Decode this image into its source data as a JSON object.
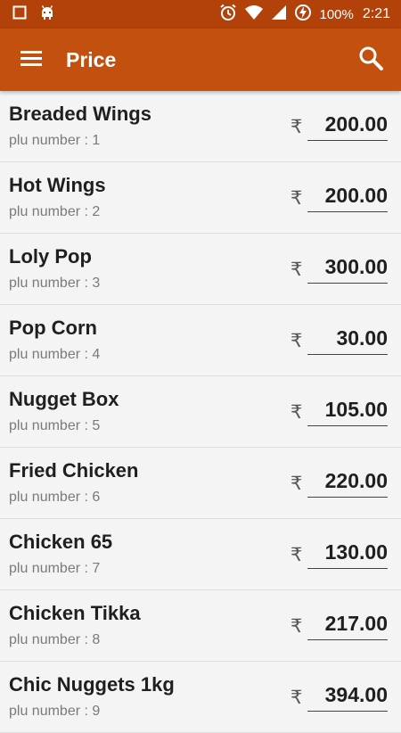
{
  "status_bar": {
    "battery": "100%",
    "time": "2:21",
    "icons": [
      "square-icon",
      "android-icon",
      "alarm-icon",
      "wifi-icon",
      "signal-icon",
      "battery-charging-icon"
    ]
  },
  "app_bar": {
    "title": "Price",
    "menu_icon": "menu-icon",
    "search_icon": "search-icon"
  },
  "currency_symbol": "₹",
  "plu_label": "plu number : ",
  "items": [
    {
      "name": "Breaded Wings",
      "plu": "1",
      "price": "200.00"
    },
    {
      "name": "Hot Wings",
      "plu": "2",
      "price": "200.00"
    },
    {
      "name": "Loly Pop",
      "plu": "3",
      "price": "300.00"
    },
    {
      "name": "Pop Corn",
      "plu": "4",
      "price": "30.00"
    },
    {
      "name": "Nugget Box",
      "plu": "5",
      "price": "105.00"
    },
    {
      "name": "Fried Chicken",
      "plu": "6",
      "price": "220.00"
    },
    {
      "name": "Chicken 65",
      "plu": "7",
      "price": "130.00"
    },
    {
      "name": "Chicken Tikka",
      "plu": "8",
      "price": "217.00"
    },
    {
      "name": "Chic Nuggets 1kg",
      "plu": "9",
      "price": "394.00"
    }
  ]
}
